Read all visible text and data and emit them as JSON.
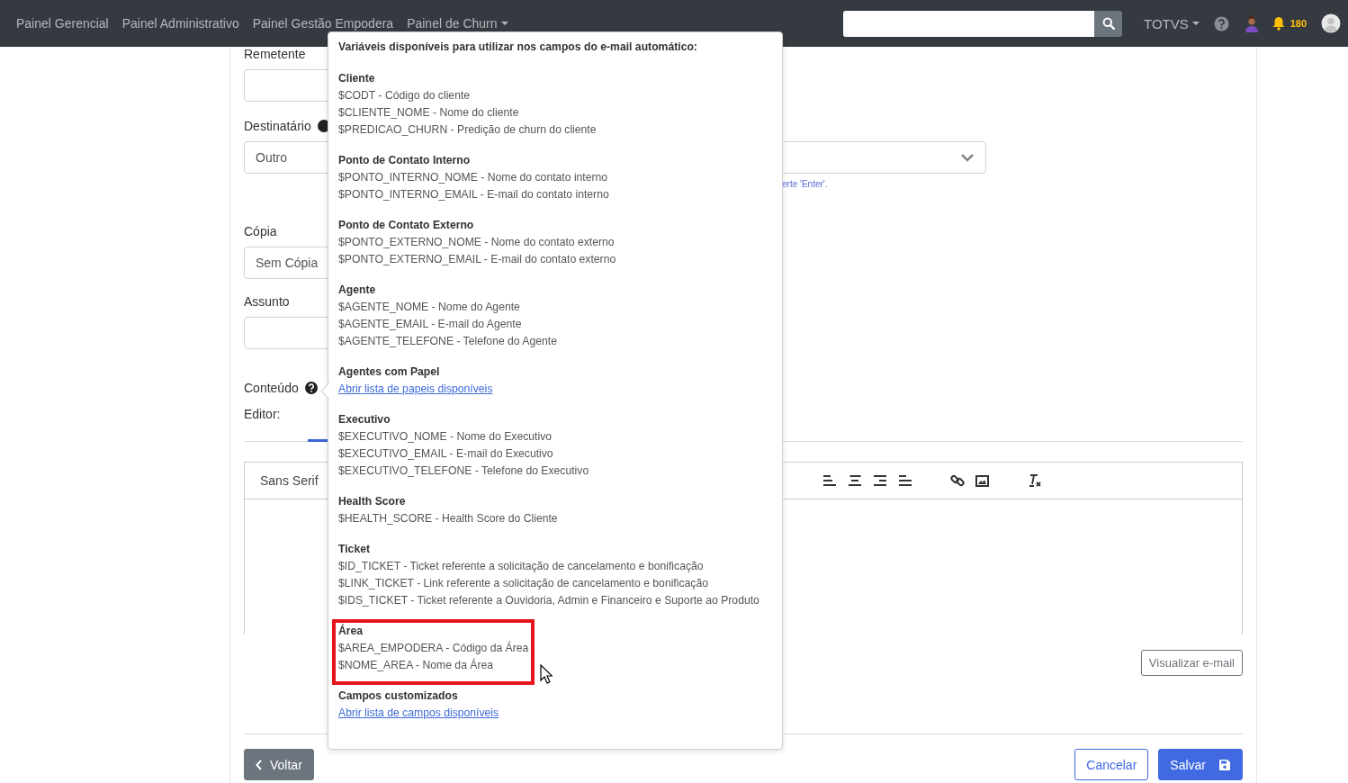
{
  "navbar": {
    "links": [
      {
        "label": "Painel Gerencial",
        "dropdown": false
      },
      {
        "label": "Painel Administrativo",
        "dropdown": false
      },
      {
        "label": "Painel Gestão Empodera",
        "dropdown": false
      },
      {
        "label": "Painel de Churn",
        "dropdown": true
      }
    ],
    "org": {
      "label": "TOTVS",
      "dropdown": true
    },
    "notifications": {
      "count": "180"
    }
  },
  "form": {
    "sender": {
      "label": "Remetente"
    },
    "recipient": {
      "label": "Destinatário",
      "value": "Outro",
      "hint": "erte 'Enter'."
    },
    "copy": {
      "label": "Cópia",
      "value": "Sem Cópia"
    },
    "subject": {
      "label": "Assunto"
    },
    "content": {
      "label": "Conteúdo"
    },
    "editor": {
      "label": "Editor:",
      "font": "Sans Serif"
    },
    "preview_button": "Visualizar e-mail",
    "back_button": "Voltar",
    "cancel_button": "Cancelar",
    "save_button": "Salvar"
  },
  "popover": {
    "title": "Variáveis disponíveis para utilizar nos campos do e-mail automático:",
    "sections": [
      {
        "title": "Cliente",
        "highlighted": false,
        "lines": [
          {
            "kind": "text",
            "text": "$CODT - Código do cliente"
          },
          {
            "kind": "text",
            "text": "$CLIENTE_NOME - Nome do cliente"
          },
          {
            "kind": "text",
            "text": "$PREDICAO_CHURN - Predição de churn do cliente"
          }
        ]
      },
      {
        "title": "Ponto de Contato Interno",
        "highlighted": false,
        "lines": [
          {
            "kind": "text",
            "text": "$PONTO_INTERNO_NOME - Nome do contato interno"
          },
          {
            "kind": "text",
            "text": "$PONTO_INTERNO_EMAIL - E-mail do contato interno"
          }
        ]
      },
      {
        "title": "Ponto de Contato Externo",
        "highlighted": false,
        "lines": [
          {
            "kind": "text",
            "text": "$PONTO_EXTERNO_NOME - Nome do contato externo"
          },
          {
            "kind": "text",
            "text": "$PONTO_EXTERNO_EMAIL - E-mail do contato externo"
          }
        ]
      },
      {
        "title": "Agente",
        "highlighted": false,
        "lines": [
          {
            "kind": "text",
            "text": "$AGENTE_NOME - Nome do Agente"
          },
          {
            "kind": "text",
            "text": "$AGENTE_EMAIL - E-mail do Agente"
          },
          {
            "kind": "text",
            "text": "$AGENTE_TELEFONE - Telefone do Agente"
          }
        ]
      },
      {
        "title": "Agentes com Papel",
        "highlighted": false,
        "lines": [
          {
            "kind": "link",
            "text": "Abrir lista de papeis disponíveis"
          }
        ]
      },
      {
        "title": "Executivo",
        "highlighted": false,
        "lines": [
          {
            "kind": "text",
            "text": "$EXECUTIVO_NOME - Nome do Executivo"
          },
          {
            "kind": "text",
            "text": "$EXECUTIVO_EMAIL - E-mail do Executivo"
          },
          {
            "kind": "text",
            "text": "$EXECUTIVO_TELEFONE - Telefone do Executivo"
          }
        ]
      },
      {
        "title": "Health Score",
        "highlighted": false,
        "lines": [
          {
            "kind": "text",
            "text": "$HEALTH_SCORE - Health Score do Cliente"
          }
        ]
      },
      {
        "title": "Ticket",
        "highlighted": false,
        "lines": [
          {
            "kind": "text",
            "text": "$ID_TICKET - Ticket referente a solicitação de cancelamento e bonificação"
          },
          {
            "kind": "text",
            "text": "$LINK_TICKET - Link referente a solicitação de cancelamento e bonificação"
          },
          {
            "kind": "text",
            "text": "$IDS_TICKET - Ticket referente a Ouvidoria, Admin e Financeiro e Suporte ao Produto"
          }
        ]
      },
      {
        "title": "Área",
        "highlighted": true,
        "lines": [
          {
            "kind": "text",
            "text": "$AREA_EMPODERA - Código da Área"
          },
          {
            "kind": "text",
            "text": "$NOME_AREA - Nome da Área"
          }
        ]
      },
      {
        "title": "Campos customizados",
        "highlighted": false,
        "lines": [
          {
            "kind": "link",
            "text": "Abrir lista de campos disponíveis"
          }
        ]
      }
    ]
  }
}
